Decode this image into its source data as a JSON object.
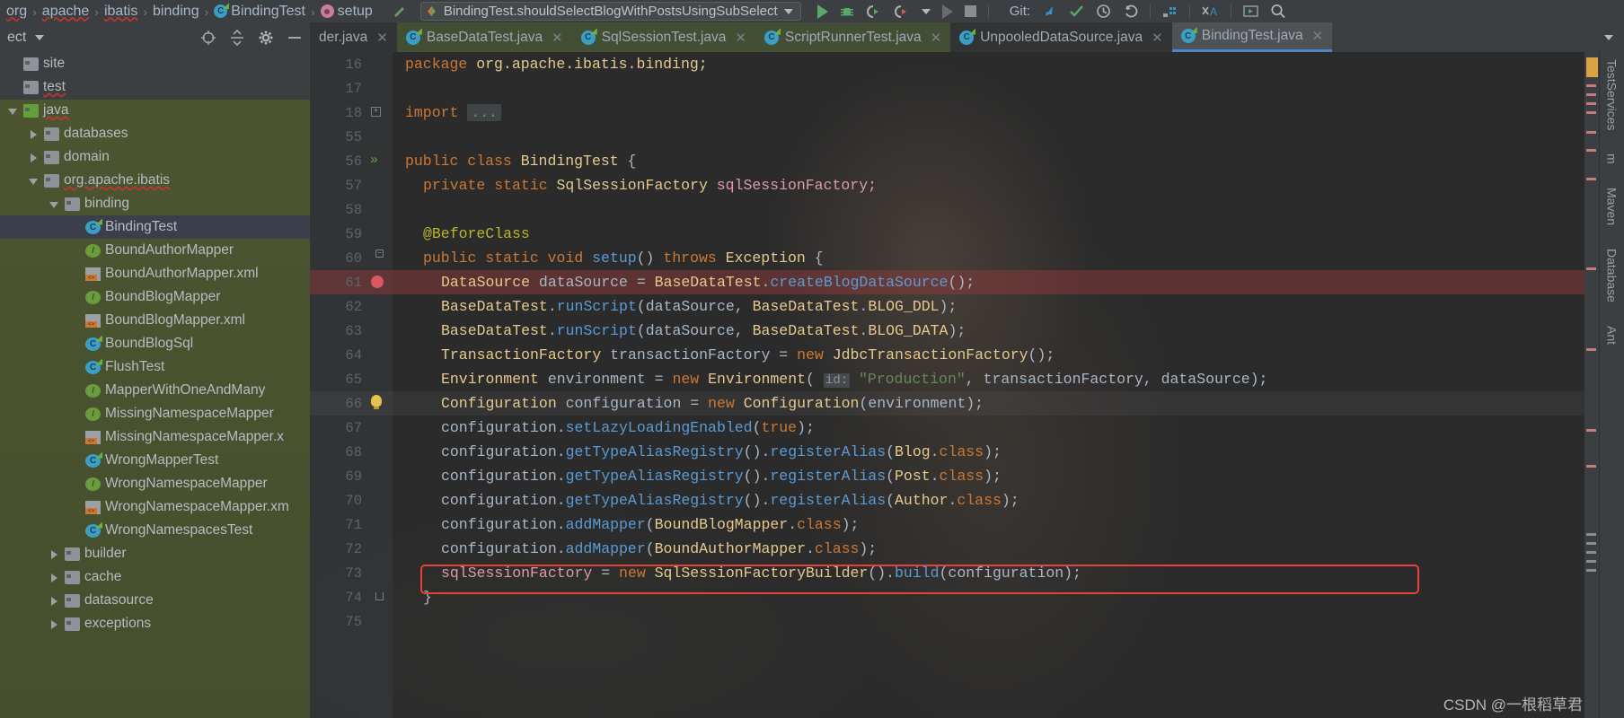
{
  "navbar": {
    "breadcrumbs": [
      {
        "label": "org",
        "icon": "none",
        "error": true
      },
      {
        "label": "apache",
        "icon": "none",
        "error": true
      },
      {
        "label": "ibatis",
        "icon": "none",
        "error": true
      },
      {
        "label": "binding",
        "icon": "none",
        "error": false
      },
      {
        "label": "BindingTest",
        "icon": "class-icon",
        "error": false
      },
      {
        "label": "setup",
        "icon": "method-icon",
        "error": false
      }
    ],
    "run_config": "BindingTest.shouldSelectBlogWithPostsUsingSubSelect",
    "git_label": "Git:",
    "toolbar_icons": [
      "run-icon",
      "debug-icon",
      "coverage-icon",
      "profile-icon",
      "dropdown-icon",
      "rerun-icon",
      "stop-icon",
      "git-update-icon",
      "git-commit-icon",
      "history-icon",
      "undo-icon",
      "layout-icon",
      "translate-icon",
      "run-anything-icon",
      "search-icon"
    ]
  },
  "project_panel": {
    "title": "ect",
    "header_icons": [
      "locate-icon",
      "collapse-all-icon",
      "settings-icon",
      "hide-icon"
    ]
  },
  "tabs": [
    {
      "label": "der.java",
      "icon": "none",
      "state": "inactive-dark",
      "closable": true
    },
    {
      "label": "BaseDataTest.java",
      "icon": "class-icon-plain",
      "state": "green",
      "closable": true
    },
    {
      "label": "SqlSessionTest.java",
      "icon": "test-class-icon",
      "state": "green",
      "closable": true
    },
    {
      "label": "ScriptRunnerTest.java",
      "icon": "test-class-icon",
      "state": "green",
      "closable": true
    },
    {
      "label": "UnpooledDataSource.java",
      "icon": "class-icon-plain",
      "state": "inactive-dark",
      "closable": true
    },
    {
      "label": "BindingTest.java",
      "icon": "test-class-icon",
      "state": "active",
      "closable": true
    }
  ],
  "tree": [
    {
      "label": "site",
      "indent": 0,
      "twist": "none",
      "icon": "folder-plain-icon",
      "selected": false,
      "error": false
    },
    {
      "label": "test",
      "indent": 0,
      "twist": "none",
      "icon": "folder-plain-icon",
      "selected": false,
      "error": true
    },
    {
      "label": "java",
      "indent": 0,
      "twist": "down",
      "icon": "source-folder-icon",
      "selected": false,
      "error": true
    },
    {
      "label": "databases",
      "indent": 1,
      "twist": "right",
      "icon": "package-icon",
      "selected": false,
      "error": false
    },
    {
      "label": "domain",
      "indent": 1,
      "twist": "right",
      "icon": "package-icon",
      "selected": false,
      "error": false
    },
    {
      "label": "org.apache.ibatis",
      "indent": 1,
      "twist": "down",
      "icon": "package-icon",
      "selected": false,
      "error": true
    },
    {
      "label": "binding",
      "indent": 2,
      "twist": "down",
      "icon": "package-icon",
      "selected": false,
      "error": false
    },
    {
      "label": "BindingTest",
      "indent": 3,
      "twist": "none",
      "icon": "test-class-icon",
      "selected": true,
      "error": false
    },
    {
      "label": "BoundAuthorMapper",
      "indent": 3,
      "twist": "none",
      "icon": "interface-icon",
      "selected": false,
      "error": false
    },
    {
      "label": "BoundAuthorMapper.xml",
      "indent": 3,
      "twist": "none",
      "icon": "xml-icon",
      "selected": false,
      "error": false
    },
    {
      "label": "BoundBlogMapper",
      "indent": 3,
      "twist": "none",
      "icon": "interface-icon",
      "selected": false,
      "error": false
    },
    {
      "label": "BoundBlogMapper.xml",
      "indent": 3,
      "twist": "none",
      "icon": "xml-icon",
      "selected": false,
      "error": false
    },
    {
      "label": "BoundBlogSql",
      "indent": 3,
      "twist": "none",
      "icon": "class-icon-plain",
      "selected": false,
      "error": false
    },
    {
      "label": "FlushTest",
      "indent": 3,
      "twist": "none",
      "icon": "test-class-icon",
      "selected": false,
      "error": false
    },
    {
      "label": "MapperWithOneAndMany",
      "indent": 3,
      "twist": "none",
      "icon": "interface-icon",
      "selected": false,
      "error": false
    },
    {
      "label": "MissingNamespaceMapper",
      "indent": 3,
      "twist": "none",
      "icon": "interface-icon",
      "selected": false,
      "error": false
    },
    {
      "label": "MissingNamespaceMapper.x",
      "indent": 3,
      "twist": "none",
      "icon": "xml-icon",
      "selected": false,
      "error": false
    },
    {
      "label": "WrongMapperTest",
      "indent": 3,
      "twist": "none",
      "icon": "test-class-icon",
      "selected": false,
      "error": false
    },
    {
      "label": "WrongNamespaceMapper",
      "indent": 3,
      "twist": "none",
      "icon": "interface-icon",
      "selected": false,
      "error": false
    },
    {
      "label": "WrongNamespaceMapper.xm",
      "indent": 3,
      "twist": "none",
      "icon": "xml-icon",
      "selected": false,
      "error": false
    },
    {
      "label": "WrongNamespacesTest",
      "indent": 3,
      "twist": "none",
      "icon": "test-class-icon",
      "selected": false,
      "error": false
    },
    {
      "label": "builder",
      "indent": 2,
      "twist": "right",
      "icon": "package-icon",
      "selected": false,
      "error": false
    },
    {
      "label": "cache",
      "indent": 2,
      "twist": "right",
      "icon": "package-icon",
      "selected": false,
      "error": false
    },
    {
      "label": "datasource",
      "indent": 2,
      "twist": "right",
      "icon": "package-icon",
      "selected": false,
      "error": false
    },
    {
      "label": "exceptions",
      "indent": 2,
      "twist": "right",
      "icon": "folder-plain-icon",
      "selected": false,
      "error": false
    }
  ],
  "editor": {
    "filename": "BindingTest.java",
    "lines": [
      {
        "num": "16",
        "indent": 0,
        "marker": "none",
        "highlight": "none",
        "spans": [
          {
            "t": "package ",
            "c": "kw2"
          },
          {
            "t": "org.apache.ibatis.binding;",
            "c": "typ"
          }
        ]
      },
      {
        "num": "17",
        "indent": 0,
        "marker": "none",
        "highlight": "none",
        "spans": []
      },
      {
        "num": "18",
        "indent": 0,
        "marker": "fold-plus",
        "highlight": "none",
        "spans": [
          {
            "t": "import ",
            "c": "kw2"
          },
          {
            "t": "...",
            "c": "fold"
          }
        ]
      },
      {
        "num": "55",
        "indent": 0,
        "marker": "none",
        "highlight": "none",
        "spans": []
      },
      {
        "num": "56",
        "indent": 0,
        "marker": "run-test",
        "highlight": "none",
        "spans": [
          {
            "t": "public class ",
            "c": "kw2"
          },
          {
            "t": "BindingTest",
            "c": "typ"
          },
          {
            "t": " {",
            "c": "pun"
          }
        ]
      },
      {
        "num": "57",
        "indent": 1,
        "marker": "none",
        "highlight": "none",
        "spans": [
          {
            "t": "private static ",
            "c": "kw2"
          },
          {
            "t": "SqlSessionFactory ",
            "c": "typ"
          },
          {
            "t": "sqlSessionFactory;",
            "c": "fld"
          }
        ]
      },
      {
        "num": "58",
        "indent": 0,
        "marker": "none",
        "highlight": "none",
        "spans": []
      },
      {
        "num": "59",
        "indent": 1,
        "marker": "none",
        "highlight": "none",
        "spans": [
          {
            "t": "@BeforeClass",
            "c": "ann"
          }
        ]
      },
      {
        "num": "60",
        "indent": 1,
        "marker": "fold-line",
        "highlight": "none",
        "spans": [
          {
            "t": "public static void ",
            "c": "kw2"
          },
          {
            "t": "setup",
            "c": "mth"
          },
          {
            "t": "() ",
            "c": "pun"
          },
          {
            "t": "throws ",
            "c": "kw2"
          },
          {
            "t": "Exception",
            "c": "typ"
          },
          {
            "t": " {",
            "c": "pun"
          }
        ]
      },
      {
        "num": "61",
        "indent": 2,
        "marker": "breakpoint",
        "highlight": "red",
        "spans": [
          {
            "t": "DataSource ",
            "c": "typ"
          },
          {
            "t": "dataSource",
            "c": "var"
          },
          {
            "t": " = ",
            "c": "pun"
          },
          {
            "t": "BaseDataTest",
            "c": "typ"
          },
          {
            "t": ".",
            "c": "pun"
          },
          {
            "t": "createBlogDataSource",
            "c": "mth"
          },
          {
            "t": "();",
            "c": "pun"
          }
        ]
      },
      {
        "num": "62",
        "indent": 2,
        "marker": "none",
        "highlight": "none",
        "spans": [
          {
            "t": "BaseDataTest",
            "c": "typ"
          },
          {
            "t": ".",
            "c": "pun"
          },
          {
            "t": "runScript",
            "c": "mth"
          },
          {
            "t": "(dataSource, ",
            "c": "pun"
          },
          {
            "t": "BaseDataTest",
            "c": "typ"
          },
          {
            "t": ".",
            "c": "pun"
          },
          {
            "t": "BLOG_DDL",
            "c": "typ"
          },
          {
            "t": ");",
            "c": "pun"
          }
        ]
      },
      {
        "num": "63",
        "indent": 2,
        "marker": "none",
        "highlight": "none",
        "spans": [
          {
            "t": "BaseDataTest",
            "c": "typ"
          },
          {
            "t": ".",
            "c": "pun"
          },
          {
            "t": "runScript",
            "c": "mth"
          },
          {
            "t": "(dataSource, ",
            "c": "pun"
          },
          {
            "t": "BaseDataTest",
            "c": "typ"
          },
          {
            "t": ".",
            "c": "pun"
          },
          {
            "t": "BLOG_DATA",
            "c": "typ"
          },
          {
            "t": ");",
            "c": "pun"
          }
        ]
      },
      {
        "num": "64",
        "indent": 2,
        "marker": "none",
        "highlight": "none",
        "spans": [
          {
            "t": "TransactionFactory ",
            "c": "typ"
          },
          {
            "t": "transactionFactory",
            "c": "var"
          },
          {
            "t": " = ",
            "c": "pun"
          },
          {
            "t": "new ",
            "c": "kw2"
          },
          {
            "t": "JdbcTransactionFactory",
            "c": "typ"
          },
          {
            "t": "();",
            "c": "pun"
          }
        ]
      },
      {
        "num": "65",
        "indent": 2,
        "marker": "none",
        "highlight": "none",
        "spans": [
          {
            "t": "Environment ",
            "c": "typ"
          },
          {
            "t": "environment",
            "c": "var"
          },
          {
            "t": " = ",
            "c": "pun"
          },
          {
            "t": "new ",
            "c": "kw2"
          },
          {
            "t": "Environment",
            "c": "typ"
          },
          {
            "t": "( ",
            "c": "pun"
          },
          {
            "t": "id:",
            "c": "hint"
          },
          {
            "t": " ",
            "c": "pun"
          },
          {
            "t": "\"Production\"",
            "c": "str"
          },
          {
            "t": ", transactionFactory, dataSource);",
            "c": "pun"
          }
        ]
      },
      {
        "num": "66",
        "indent": 2,
        "marker": "bulb",
        "highlight": "soft",
        "spans": [
          {
            "t": "Configuration ",
            "c": "typ"
          },
          {
            "t": "configuration",
            "c": "var"
          },
          {
            "t": " = ",
            "c": "pun"
          },
          {
            "t": "new ",
            "c": "kw2"
          },
          {
            "t": "Configuration",
            "c": "typ"
          },
          {
            "t": "(environment);",
            "c": "pun"
          }
        ]
      },
      {
        "num": "67",
        "indent": 2,
        "marker": "none",
        "highlight": "none",
        "spans": [
          {
            "t": "configuration.",
            "c": "var"
          },
          {
            "t": "setLazyLoadingEnabled",
            "c": "mth"
          },
          {
            "t": "(",
            "c": "pun"
          },
          {
            "t": "true",
            "c": "kw2"
          },
          {
            "t": ");",
            "c": "pun"
          }
        ]
      },
      {
        "num": "68",
        "indent": 2,
        "marker": "none",
        "highlight": "none",
        "spans": [
          {
            "t": "configuration.",
            "c": "var"
          },
          {
            "t": "getTypeAliasRegistry",
            "c": "mth"
          },
          {
            "t": "().",
            "c": "pun"
          },
          {
            "t": "registerAlias",
            "c": "mth"
          },
          {
            "t": "(",
            "c": "pun"
          },
          {
            "t": "Blog",
            "c": "typ"
          },
          {
            "t": ".",
            "c": "pun"
          },
          {
            "t": "class",
            "c": "kw2"
          },
          {
            "t": ");",
            "c": "pun"
          }
        ]
      },
      {
        "num": "69",
        "indent": 2,
        "marker": "none",
        "highlight": "none",
        "spans": [
          {
            "t": "configuration.",
            "c": "var"
          },
          {
            "t": "getTypeAliasRegistry",
            "c": "mth"
          },
          {
            "t": "().",
            "c": "pun"
          },
          {
            "t": "registerAlias",
            "c": "mth"
          },
          {
            "t": "(",
            "c": "pun"
          },
          {
            "t": "Post",
            "c": "typ"
          },
          {
            "t": ".",
            "c": "pun"
          },
          {
            "t": "class",
            "c": "kw2"
          },
          {
            "t": ");",
            "c": "pun"
          }
        ]
      },
      {
        "num": "70",
        "indent": 2,
        "marker": "none",
        "highlight": "none",
        "spans": [
          {
            "t": "configuration.",
            "c": "var"
          },
          {
            "t": "getTypeAliasRegistry",
            "c": "mth"
          },
          {
            "t": "().",
            "c": "pun"
          },
          {
            "t": "registerAlias",
            "c": "mth"
          },
          {
            "t": "(",
            "c": "pun"
          },
          {
            "t": "Author",
            "c": "typ"
          },
          {
            "t": ".",
            "c": "pun"
          },
          {
            "t": "class",
            "c": "kw2"
          },
          {
            "t": ");",
            "c": "pun"
          }
        ]
      },
      {
        "num": "71",
        "indent": 2,
        "marker": "none",
        "highlight": "none",
        "spans": [
          {
            "t": "configuration.",
            "c": "var"
          },
          {
            "t": "addMapper",
            "c": "mth"
          },
          {
            "t": "(",
            "c": "pun"
          },
          {
            "t": "BoundBlogMapper",
            "c": "typ"
          },
          {
            "t": ".",
            "c": "pun"
          },
          {
            "t": "class",
            "c": "kw2"
          },
          {
            "t": ");",
            "c": "pun"
          }
        ]
      },
      {
        "num": "72",
        "indent": 2,
        "marker": "none",
        "highlight": "none",
        "spans": [
          {
            "t": "configuration.",
            "c": "var"
          },
          {
            "t": "addMapper",
            "c": "mth"
          },
          {
            "t": "(",
            "c": "pun"
          },
          {
            "t": "BoundAuthorMapper",
            "c": "typ"
          },
          {
            "t": ".",
            "c": "pun"
          },
          {
            "t": "class",
            "c": "kw2"
          },
          {
            "t": ");",
            "c": "pun"
          }
        ]
      },
      {
        "num": "73",
        "indent": 2,
        "marker": "none",
        "highlight": "none",
        "spans": [
          {
            "t": "sqlSessionFactory",
            "c": "fld"
          },
          {
            "t": " = ",
            "c": "pun"
          },
          {
            "t": "new ",
            "c": "kw2"
          },
          {
            "t": "SqlSessionFactoryBuilder",
            "c": "typ"
          },
          {
            "t": "().",
            "c": "pun"
          },
          {
            "t": "build",
            "c": "mth"
          },
          {
            "t": "(configuration);",
            "c": "pun"
          }
        ]
      },
      {
        "num": "74",
        "indent": 1,
        "marker": "fold-end",
        "highlight": "none",
        "spans": [
          {
            "t": "}",
            "c": "pun"
          }
        ]
      },
      {
        "num": "75",
        "indent": 0,
        "marker": "none",
        "highlight": "none",
        "spans": []
      }
    ],
    "highlight_box_line": "73",
    "accent_color": "#e8413c"
  },
  "right_sidebar": {
    "tabs": [
      "TestServices",
      "m",
      "Maven",
      "Database",
      "Ant"
    ]
  },
  "watermark": "CSDN @一根稻草君"
}
